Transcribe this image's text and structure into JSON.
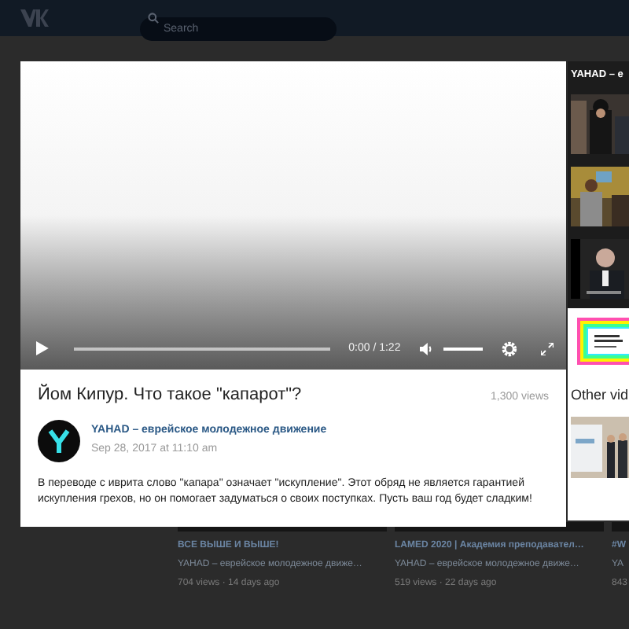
{
  "header": {
    "search": {
      "placeholder": "Search"
    }
  },
  "player": {
    "progress": {
      "level": 0
    },
    "time": "0:00 / 1:22",
    "volume": {
      "level": 1
    }
  },
  "video": {
    "title": "Йом Кипур. Что такое \"капарот\"?",
    "views": "1,300 views",
    "channel": "YAHAD – еврейское молодежное движение",
    "date": "Sep 28, 2017 at 11:10 am",
    "description": "В переводе с иврита слово \"капара\" означает \"искупление\". Этот обряд не является гарантией искупления грехов, но он помогает задуматься о своих поступках. Пусть ваш год будет сладким!"
  },
  "playlist": {
    "title": "YAHAD – е"
  },
  "other_videos": {
    "title": "Other vid"
  },
  "background_videos": [
    {
      "title": "ВСЕ ВЫШЕ И ВЫШЕ!",
      "channel": "YAHAD – еврейское молодежное движе…",
      "meta": "704 views · 14 days ago"
    },
    {
      "title": "LAMED 2020 | Академия преподавател…",
      "channel": "YAHAD – еврейское молодежное движе…",
      "meta": "519 views · 22 days ago"
    },
    {
      "title": "#W",
      "channel": "YA",
      "meta": "843"
    }
  ]
}
